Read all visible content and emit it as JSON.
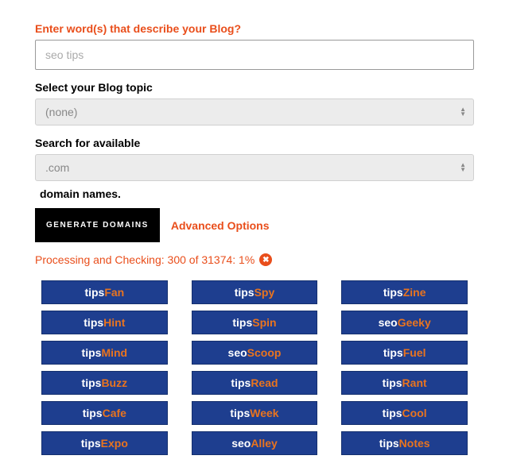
{
  "form": {
    "prompt_label": "Enter word(s) that describe your Blog?",
    "input_value": "seo tips",
    "topic_label": "Select your Blog topic",
    "topic_value": "(none)",
    "tld_label": "Search for available",
    "tld_value": ".com",
    "tld_suffix": "domain names.",
    "generate_label": "GENERATE DOMAINS",
    "advanced_label": "Advanced Options"
  },
  "status": {
    "text": "Processing and Checking: 300 of 31374: 1%",
    "close_glyph": "✖"
  },
  "results": [
    [
      {
        "p": "tips",
        "s": "Fan"
      },
      {
        "p": "tips",
        "s": "Spy"
      },
      {
        "p": "tips",
        "s": "Zine"
      }
    ],
    [
      {
        "p": "tips",
        "s": "Hint"
      },
      {
        "p": "tips",
        "s": "Spin"
      },
      {
        "p": "seo",
        "s": "Geeky"
      }
    ],
    [
      {
        "p": "tips",
        "s": "Mind"
      },
      {
        "p": "seo",
        "s": "Scoop"
      },
      {
        "p": "tips",
        "s": "Fuel"
      }
    ],
    [
      {
        "p": "tips",
        "s": "Buzz"
      },
      {
        "p": "tips",
        "s": "Read"
      },
      {
        "p": "tips",
        "s": "Rant"
      }
    ],
    [
      {
        "p": "tips",
        "s": "Cafe"
      },
      {
        "p": "tips",
        "s": "Week"
      },
      {
        "p": "tips",
        "s": "Cool"
      }
    ],
    [
      {
        "p": "tips",
        "s": "Expo"
      },
      {
        "p": "seo",
        "s": "Alley"
      },
      {
        "p": "tips",
        "s": "Notes"
      }
    ]
  ]
}
